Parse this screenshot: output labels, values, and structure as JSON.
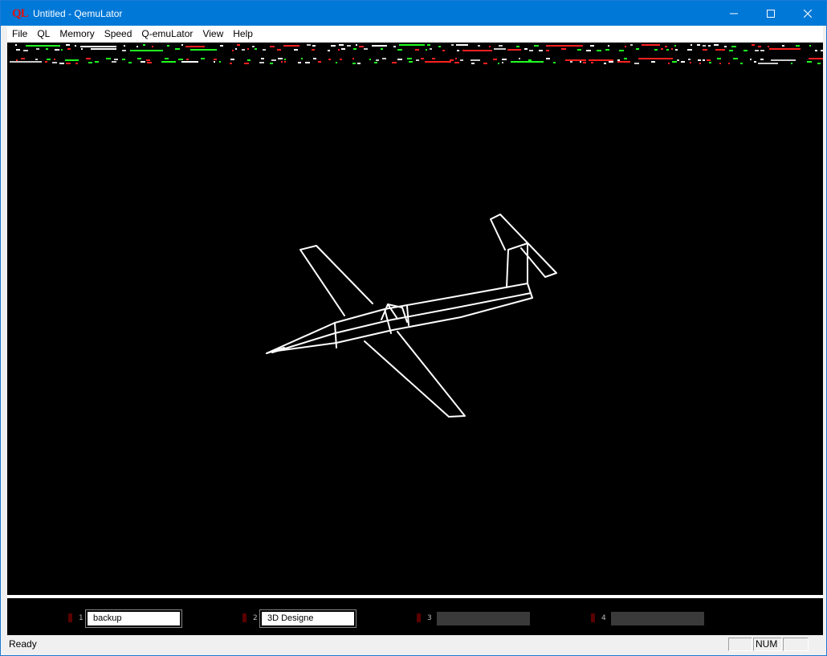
{
  "window": {
    "title": "Untitled - QemuLator",
    "logo_text": "QL"
  },
  "menu": [
    "File",
    "QL",
    "Memory",
    "Speed",
    "Q-emuLator",
    "View",
    "Help"
  ],
  "screen": {
    "background": "#000000",
    "content": "3D wireframe airplane"
  },
  "taskbar": {
    "slots": [
      {
        "number": "1",
        "label": "backup",
        "active": true
      },
      {
        "number": "2",
        "label": "3D Designe",
        "active": true
      },
      {
        "number": "3",
        "label": "",
        "active": false
      },
      {
        "number": "4",
        "label": "",
        "active": false
      }
    ]
  },
  "status": {
    "text": "Ready",
    "num_indicator": "NUM"
  },
  "colors": {
    "titlebar": "#0078d7",
    "logo": "#e01010"
  }
}
